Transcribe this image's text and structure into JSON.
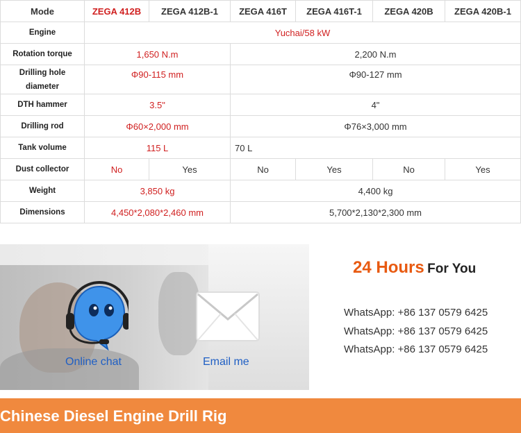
{
  "table": {
    "header": {
      "label": "Mode",
      "models": [
        "ZEGA 412B",
        "ZEGA 412B-1",
        "ZEGA 416T",
        "ZEGA 416T-1",
        "ZEGA 420B",
        "ZEGA 420B-1"
      ]
    },
    "engine": {
      "label": "Engine",
      "value": "Yuchai/58 kW"
    },
    "rotation_torque": {
      "label": "Rotation torque",
      "value_a": "1,650 N.m",
      "value_b": "2,200 N.m"
    },
    "drilling_hole_diameter": {
      "label_line1": "Drilling hole",
      "label_line2": "diameter",
      "value_a": "Φ90-115 mm",
      "value_b": "Φ90-127 mm"
    },
    "dth_hammer": {
      "label": "DTH hammer",
      "value_a": "3.5\"",
      "value_b": "4\""
    },
    "drilling_rod": {
      "label": "Drilling rod",
      "value_a": "Φ60×2,000 mm",
      "value_b": "Φ76×3,000 mm"
    },
    "tank_volume": {
      "label": "Tank volume",
      "value_a": "115 L",
      "value_b": "70 L"
    },
    "dust_collector": {
      "label": "Dust collector",
      "values": [
        "No",
        "Yes",
        "No",
        "Yes",
        "No",
        "Yes"
      ]
    },
    "weight": {
      "label": "Weight",
      "value_a": "3,850 kg",
      "value_b": "4,400 kg"
    },
    "dimensions": {
      "label": "Dimensions",
      "value_a": "4,450*2,080*2,460 mm",
      "value_b": "5,700*2,130*2,300 mm"
    }
  },
  "banner": {
    "chat_label": "Online chat",
    "email_label": "Email me",
    "chat_icon": "headset-chat-icon",
    "email_icon": "envelope-icon"
  },
  "contact": {
    "title_highlight": "24 Hours",
    "title_rest": "For You",
    "lines": [
      "WhatsApp: +86 137 0579 6425",
      "WhatsApp: +86 137 0579 6425",
      "WhatsApp: +86 137 0579 6425"
    ]
  },
  "footer": {
    "title": "Chinese Diesel Engine Drill Rig"
  },
  "colors": {
    "accent_red": "#d01f1f",
    "accent_orange": "#e85a11",
    "footer_bg": "#f0893e",
    "link_blue": "#1f5fc4"
  }
}
